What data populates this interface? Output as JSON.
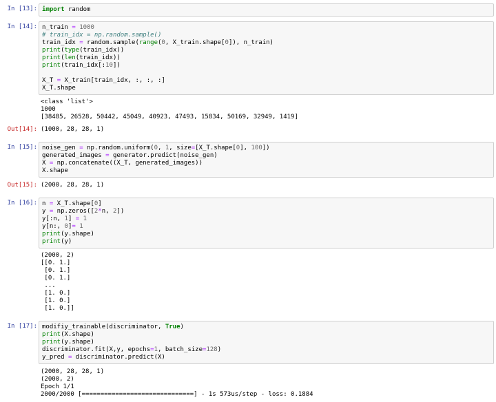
{
  "cells": [
    {
      "in_prompt": "In [13]:",
      "code": [
        [
          "kw:import",
          " random"
        ]
      ],
      "outputs": []
    },
    {
      "in_prompt": "In [14]:",
      "code": [
        [
          "n_train ",
          "op:=",
          " ",
          "num:1000"
        ],
        [
          "cm:# train_idx = np.random.sample()"
        ],
        [
          "train_idx ",
          "op:=",
          " random.sample(",
          "bi:range",
          "(",
          "num:0",
          ", X_train.shape[",
          "num:0",
          "]), n_train)"
        ],
        [
          "bi:print",
          "(",
          "bi:type",
          "(train_idx))"
        ],
        [
          "bi:print",
          "(",
          "bi:len",
          "(train_idx))"
        ],
        [
          "bi:print",
          "(train_idx[:",
          "num:10",
          "])"
        ],
        [
          ""
        ],
        [
          "X_T ",
          "op:=",
          " X_train[train_idx, :, :, :]"
        ],
        [
          "X_T.shape"
        ]
      ],
      "stream": [
        "<class 'list'>",
        "1000",
        "[38485, 26528, 50442, 45049, 40923, 47493, 15834, 50169, 32949, 1419]"
      ],
      "out_prompt": "Out[14]:",
      "out_value": "(1000, 28, 28, 1)"
    },
    {
      "in_prompt": "In [15]:",
      "code": [
        [
          "noise_gen ",
          "op:=",
          " np.random.uniform(",
          "num:0",
          ", ",
          "num:1",
          ", size",
          "op:=",
          "[X_T.shape[",
          "num:0",
          "], ",
          "num:100",
          "])"
        ],
        [
          "generated_images ",
          "op:=",
          " generator.predict(noise_gen)"
        ],
        [
          "X ",
          "op:=",
          " np.concatenate((X_T, generated_images))"
        ],
        [
          "X.shape"
        ]
      ],
      "out_prompt": "Out[15]:",
      "out_value": "(2000, 28, 28, 1)"
    },
    {
      "in_prompt": "In [16]:",
      "code": [
        [
          "n ",
          "op:=",
          " X_T.shape[",
          "num:0",
          "]"
        ],
        [
          "y ",
          "op:=",
          " np.zeros([",
          "num:2",
          "op:*",
          "n, ",
          "num:2",
          "])"
        ],
        [
          "y[:n, ",
          "num:1",
          "] ",
          "op:=",
          " ",
          "num:1"
        ],
        [
          "y[n:, ",
          "num:0",
          "]",
          "op:=",
          " ",
          "num:1"
        ],
        [
          "bi:print",
          "(y.shape)"
        ],
        [
          "bi:print",
          "(y)"
        ]
      ],
      "stream": [
        "(2000, 2)",
        "[[0. 1.]",
        " [0. 1.]",
        " [0. 1.]",
        " ...",
        " [1. 0.]",
        " [1. 0.]",
        " [1. 0.]]"
      ]
    },
    {
      "in_prompt": "In [17]:",
      "code": [
        [
          "modifiy_trainable(discriminator, ",
          "kw:True",
          ")"
        ],
        [
          "bi:print",
          "(X.shape)"
        ],
        [
          "bi:print",
          "(y.shape)"
        ],
        [
          "discriminator.fit(X,y, epochs",
          "op:=",
          "num:1",
          ", batch_size",
          "op:=",
          "num:128",
          ")"
        ],
        [
          "y_pred ",
          "op:=",
          " discriminator.predict(X)"
        ]
      ],
      "stream": [
        "(2000, 28, 28, 1)",
        "(2000, 2)",
        "Epoch 1/1",
        "2000/2000 [==============================] - 1s 573us/step - loss: 0.1884"
      ]
    }
  ]
}
